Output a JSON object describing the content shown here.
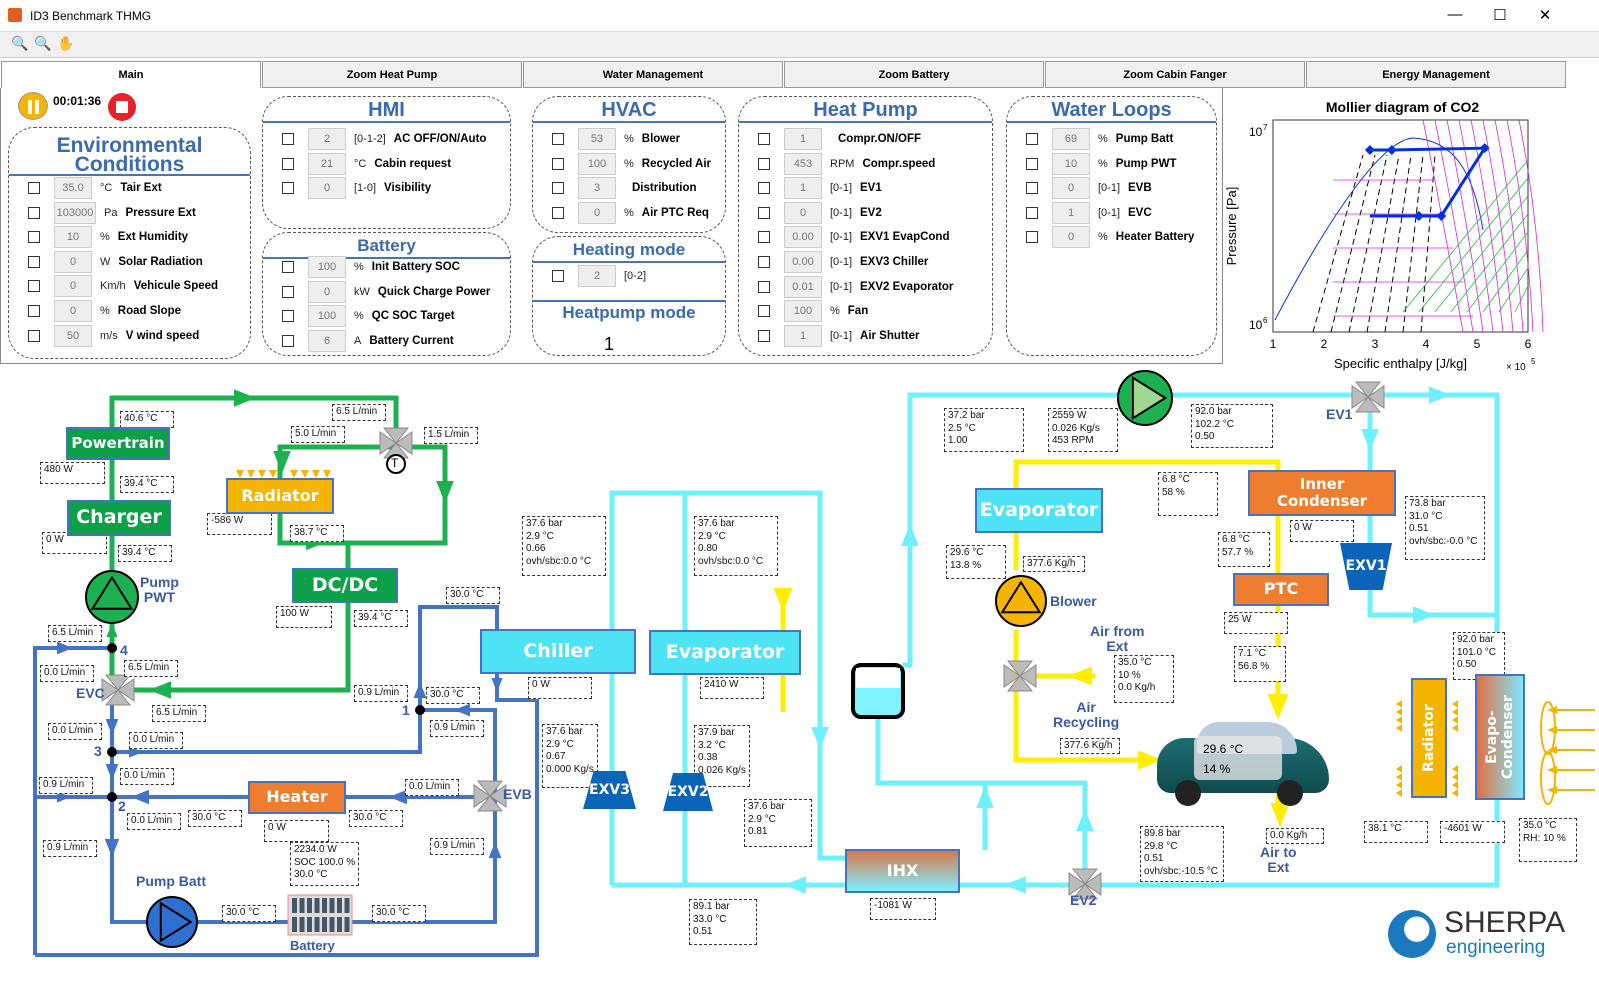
{
  "window": {
    "title": "ID3  Benchmark THMG",
    "minimize": "—",
    "maximize": "☐",
    "close": "✕"
  },
  "toolbar": [
    {
      "icon": "zoom-in-icon",
      "glyph": "🔍"
    },
    {
      "icon": "zoom-out-icon",
      "glyph": "🔍"
    },
    {
      "icon": "pan-hand-icon",
      "glyph": "✋"
    }
  ],
  "tabs": [
    {
      "label": "Main",
      "active": true
    },
    {
      "label": "Zoom Heat Pump"
    },
    {
      "label": "Water Management"
    },
    {
      "label": "Zoom Battery"
    },
    {
      "label": "Zoom Cabin Fanger"
    },
    {
      "label": "Energy Management"
    }
  ],
  "sim": {
    "time": "00:01:36",
    "pause_color": "#f5b400",
    "stop_color": "#e8202a"
  },
  "panels": {
    "env": {
      "title": "Environmental\nConditions",
      "rows": [
        {
          "value": "35.0",
          "unit": "°C",
          "label": "Tair Ext"
        },
        {
          "value": "103000",
          "unit": "Pa",
          "label": "Pressure Ext"
        },
        {
          "value": "10",
          "unit": "%",
          "label": "Ext Humidity"
        },
        {
          "value": "0",
          "unit": "W",
          "label": "Solar Radiation"
        },
        {
          "value": "0",
          "unit": "Km/h",
          "label": "Vehicule Speed"
        },
        {
          "value": "0",
          "unit": "%",
          "label": "Road Slope"
        },
        {
          "value": "50",
          "unit": "m/s",
          "label": "V wind speed"
        }
      ]
    },
    "hmi": {
      "title": "HMI",
      "rows": [
        {
          "value": "2",
          "unit": "[0-1-2]",
          "label": "AC OFF/ON/Auto"
        },
        {
          "value": "21",
          "unit": "°C",
          "label": "Cabin request"
        },
        {
          "value": "0",
          "unit": "[1-0]",
          "label": "Visibility"
        }
      ]
    },
    "battery": {
      "title": "Battery",
      "rows": [
        {
          "value": "100",
          "unit": "%",
          "label": "Init Battery SOC"
        },
        {
          "value": "0",
          "unit": "kW",
          "label": "Quick Charge Power"
        },
        {
          "value": "100",
          "unit": "%",
          "label": "QC SOC Target"
        },
        {
          "value": "6",
          "unit": "A",
          "label": "Battery Current"
        }
      ]
    },
    "hvac": {
      "title": "HVAC",
      "rows": [
        {
          "value": "53",
          "unit": "%",
          "label": "Blower"
        },
        {
          "value": "100",
          "unit": "%",
          "label": "Recycled Air"
        },
        {
          "value": "3",
          "unit": "",
          "label": "Distribution"
        },
        {
          "value": "0",
          "unit": "%",
          "label": "Air PTC Req"
        }
      ]
    },
    "heating": {
      "title": "Heating mode",
      "rows": [
        {
          "value": "2",
          "unit": "[0-2]",
          "label": ""
        }
      ],
      "heatpump_title": "Heatpump mode",
      "heatpump_value": "1"
    },
    "heatpump": {
      "title": "Heat Pump",
      "rows": [
        {
          "value": "1",
          "unit": "",
          "label": "Compr.ON/OFF"
        },
        {
          "value": "453",
          "unit": "RPM",
          "label": "Compr.speed"
        },
        {
          "value": "1",
          "unit": "[0-1]",
          "label": "EV1"
        },
        {
          "value": "0",
          "unit": "[0-1]",
          "label": "EV2"
        },
        {
          "value": "0.00",
          "unit": "[0-1]",
          "label": "EXV1 EvapCond"
        },
        {
          "value": "0.00",
          "unit": "[0-1]",
          "label": "EXV3 Chiller"
        },
        {
          "value": "0.01",
          "unit": "[0-1]",
          "label": "EXV2 Evaporator"
        },
        {
          "value": "100",
          "unit": "%",
          "label": "Fan"
        },
        {
          "value": "1",
          "unit": "[0-1]",
          "label": "Air Shutter"
        }
      ]
    },
    "water": {
      "title": "Water Loops",
      "rows": [
        {
          "value": "69",
          "unit": "%",
          "label": "Pump Batt"
        },
        {
          "value": "10",
          "unit": "%",
          "label": "Pump PWT"
        },
        {
          "value": "0",
          "unit": "[0-1]",
          "label": "EVB"
        },
        {
          "value": "1",
          "unit": "[0-1]",
          "label": "EVC"
        },
        {
          "value": "0",
          "unit": "%",
          "label": "Heater Battery"
        }
      ]
    }
  },
  "mollier": {
    "title": "Mollier diagram of CO2",
    "xlabel": "Specific enthalpy [J/kg]",
    "ylabel": "Pressure [Pa]",
    "x_ticks": [
      "1",
      "2",
      "3",
      "4",
      "5",
      "6"
    ],
    "x_multiplier": "× 10",
    "x_exp": "5",
    "y_ticks": [
      {
        "base": "10",
        "exp": "7"
      },
      {
        "base": "10",
        "exp": "6"
      }
    ],
    "chart_data": {
      "type": "line",
      "xlim": [
        100000,
        600000
      ],
      "ylim": [
        1000000,
        10000000
      ],
      "yscale": "log",
      "cycle_h": [
        290000,
        333000,
        515000,
        430000,
        386000,
        290000
      ],
      "cycle_p": [
        8600000,
        8600000,
        8800000,
        3750000,
        3750000,
        3750000
      ],
      "colors": {
        "cycle": "#0030e0",
        "dome": "#0030e0",
        "isotherms": "#e020e0",
        "isentropes": "#20c040"
      }
    }
  },
  "components": {
    "powertrain": "Powertrain",
    "charger": "Charger",
    "radiator": "Radiator",
    "dcdc": "DC/DC",
    "chiller": "Chiller",
    "evaporator": "Evaporator",
    "heater": "Heater",
    "ihx": "IHX",
    "evaporator_hvac": "Evaporator",
    "inner_condenser": "Inner\nCondenser",
    "ptc": "PTC",
    "exv1": "EXV1",
    "exv2": "EXV2",
    "exv3": "EXV3",
    "front_radiator": "Radiator",
    "evapo_condenser": "Evapo-\nCondenser"
  },
  "labels": {
    "pump_pwt": "Pump\nPWT",
    "evc": "EVC",
    "pump_batt": "Pump Batt",
    "battery": "Battery",
    "evb": "EVB",
    "blower": "Blower",
    "air_from_ext": "Air from\nExt",
    "air_recycling": "Air\nRecycling",
    "air_to_ext": "Air to\nExt",
    "ev1": "EV1",
    "ev2": "EV2",
    "j4": "4",
    "j1": "1",
    "j3": "3",
    "j2": "2",
    "thermostat": "T"
  },
  "cabin": {
    "temp": "29.6 °C",
    "rh": "14 %"
  },
  "values": {
    "g1": "40.6 °C",
    "g2": "6.5 L/min",
    "g3": "5.0 L/min",
    "g4": "1.5 L/min",
    "g5": "480 W",
    "g6": "39.4 °C",
    "g7": "-586 W",
    "g8": "38.7 °C",
    "g9": "0 W",
    "g10": "39.4 °C",
    "g11": "100 W",
    "g12": "39.4 °C",
    "g13": "30.0 °C",
    "g14": "6.5 L/min",
    "g15": "6.5 L/min",
    "g16": "0.0 L/min",
    "g17": "6.5 L/min",
    "g18": "0.9 L/min",
    "g19": "30.0 °C",
    "g20": "0.0 L/min",
    "g21": "0.9 L/min",
    "g22": "0.0 L/min",
    "g23": "0.0 L/min",
    "g24": "0.9 L/min",
    "g25": "0.0 L/min",
    "g26": "0.0 L/min",
    "g27": "30.0 °C",
    "g28": "30.0 °C",
    "g29": "0 W",
    "g30": "0.9 L/min",
    "g31": "0.9 L/min",
    "g32": "2234.0 W\nSOC 100.0 %\n30.0 °C",
    "g33": "30.0 °C",
    "g34": "30.0 °C",
    "c1": "37.6 bar\n2.9 °C\n0.66\novh/sbc:0.0 °C",
    "c2": "37.6 bar\n2.9 °C\n0.80\novh/sbc:0.0 °C",
    "c3": "0 W",
    "c4": "2410 W",
    "c5": "37.6 bar\n2.9 °C\n0.67\n0.000 Kg/s",
    "c6": "37.9 bar\n3.2 °C\n0.38\n0.026 Kg/s",
    "c7": "37.6 bar\n2.9 °C\n0.81",
    "c8": "89.1 bar\n33.0 °C\n0.51",
    "c9": "-1081 W",
    "c10": "37.2 bar\n2.5 °C\n1.00",
    "c11": "2559 W\n0.026 Kg/s\n453 RPM",
    "c12": "92.0 bar\n102.2 °C\n0.50",
    "c13": "6.8 °C\n58 %",
    "c14": "73.8 bar\n31.0 °C\n0.51\novh/sbc:-0.0 °C",
    "c15": "0 W",
    "c16": "6.8 °C\n57.7 %",
    "c17": "29.6 °C\n13.8 %",
    "c18": "377.6 Kg/h",
    "c19": "25 W",
    "c20": "7.1 °C\n56.8 %",
    "c21": "92.0 bar\n101.0 °C\n0.50",
    "c22": "35.0 °C\n10 %\n0.0 Kg/h",
    "c23": "377.6 Kg/h",
    "c24": "89.8 bar\n29.8 °C\n0.51\novh/sbc:-10.5 °C",
    "c25": "0.0 Kg/h",
    "c26": "38.1 °C",
    "c27": "-4601 W",
    "c28": "35.0 °C\nRH: 10 %"
  },
  "logo": {
    "text": "SHERPA",
    "sub": "engineering"
  },
  "colors": {
    "coolant_pwt": "#1db050",
    "coolant_batt": "#4472c4",
    "refrigerant": "#6ff0ff",
    "air": "#ffee00",
    "title_blue": "#3a6ab0"
  }
}
